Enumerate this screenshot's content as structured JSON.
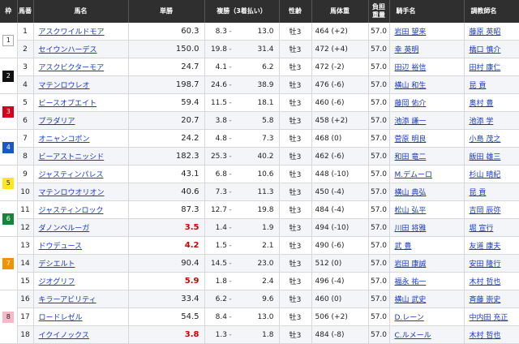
{
  "headers": {
    "waku": "枠",
    "umaban": "馬番",
    "horse": "馬名",
    "win_odds": "単勝",
    "place_odds": "複勝（3着払い）",
    "sex_age": "性齢",
    "body_weight": "馬体重",
    "weight_line1": "負担",
    "weight_line2": "重量",
    "jockey": "騎手名",
    "trainer": "調教師名"
  },
  "waku_colors": {
    "1": {
      "bg": "#ffffff",
      "fg": "#222222"
    },
    "2": {
      "bg": "#111111",
      "fg": "#ffffff"
    },
    "3": {
      "bg": "#d6001c",
      "fg": "#ffffff"
    },
    "4": {
      "bg": "#1a57c9",
      "fg": "#ffffff"
    },
    "5": {
      "bg": "#ffe81a",
      "fg": "#222222"
    },
    "6": {
      "bg": "#14863a",
      "fg": "#ffffff"
    },
    "7": {
      "bg": "#f39200",
      "fg": "#ffffff"
    },
    "8": {
      "bg": "#f7b8c8",
      "fg": "#222222"
    }
  },
  "rows": [
    {
      "waku": "1",
      "num": "1",
      "horse": "アスクワイルドモア",
      "win": "60.3",
      "hot": false,
      "pmin": "8.3",
      "pmax": "13.0",
      "sex": "牡3",
      "bw": "464 (+2)",
      "wt": "57.0",
      "jockey": "岩田 望来",
      "trainer": "藤原 英昭"
    },
    {
      "waku": "1",
      "num": "2",
      "horse": "セイウンハーデス",
      "win": "150.0",
      "hot": false,
      "pmin": "19.8",
      "pmax": "31.4",
      "sex": "牡3",
      "bw": "472 (+4)",
      "wt": "57.0",
      "jockey": "幸 英明",
      "trainer": "橋口 慎介"
    },
    {
      "waku": "2",
      "num": "3",
      "horse": "アスクビクターモア",
      "win": "24.7",
      "hot": false,
      "pmin": "4.1",
      "pmax": "6.2",
      "sex": "牡3",
      "bw": "472 (-2)",
      "wt": "57.0",
      "jockey": "田辺 裕信",
      "trainer": "田村 康仁"
    },
    {
      "waku": "2",
      "num": "4",
      "horse": "マテンロウレオ",
      "win": "198.7",
      "hot": false,
      "pmin": "24.6",
      "pmax": "38.9",
      "sex": "牡3",
      "bw": "476 (-6)",
      "wt": "57.0",
      "jockey": "横山 和生",
      "trainer": "昆 貢"
    },
    {
      "waku": "3",
      "num": "5",
      "horse": "ビースオブエイト",
      "win": "59.4",
      "hot": false,
      "pmin": "11.5",
      "pmax": "18.1",
      "sex": "牡3",
      "bw": "460 (-6)",
      "wt": "57.0",
      "jockey": "藤岡 佑介",
      "trainer": "奥村 豊"
    },
    {
      "waku": "3",
      "num": "6",
      "horse": "プラダリア",
      "win": "20.7",
      "hot": false,
      "pmin": "3.8",
      "pmax": "5.8",
      "sex": "牡3",
      "bw": "458 (+2)",
      "wt": "57.0",
      "jockey": "池添 謙一",
      "trainer": "池添 学"
    },
    {
      "waku": "4",
      "num": "7",
      "horse": "オニャンコポン",
      "win": "24.2",
      "hot": false,
      "pmin": "4.8",
      "pmax": "7.3",
      "sex": "牡3",
      "bw": "468 (0)",
      "wt": "57.0",
      "jockey": "菅原 明良",
      "trainer": "小島 茂之"
    },
    {
      "waku": "4",
      "num": "8",
      "horse": "ビーアストニッシド",
      "win": "182.3",
      "hot": false,
      "pmin": "25.3",
      "pmax": "40.2",
      "sex": "牡3",
      "bw": "462 (-6)",
      "wt": "57.0",
      "jockey": "和田 竜二",
      "trainer": "飯田 雄三"
    },
    {
      "waku": "5",
      "num": "9",
      "horse": "ジャスティンパレス",
      "win": "43.1",
      "hot": false,
      "pmin": "6.8",
      "pmax": "10.6",
      "sex": "牡3",
      "bw": "448 (-10)",
      "wt": "57.0",
      "jockey": "M.デムーロ",
      "trainer": "杉山 晴紀"
    },
    {
      "waku": "5",
      "num": "10",
      "horse": "マテンロウオリオン",
      "win": "40.6",
      "hot": false,
      "pmin": "7.3",
      "pmax": "11.3",
      "sex": "牡3",
      "bw": "450 (-4)",
      "wt": "57.0",
      "jockey": "横山 典弘",
      "trainer": "昆 貢"
    },
    {
      "waku": "6",
      "num": "11",
      "horse": "ジャスティンロック",
      "win": "87.3",
      "hot": false,
      "pmin": "12.7",
      "pmax": "19.8",
      "sex": "牡3",
      "bw": "484 (-4)",
      "wt": "57.0",
      "jockey": "松山 弘平",
      "trainer": "吉岡 辰弥"
    },
    {
      "waku": "6",
      "num": "12",
      "horse": "ダノンベルーガ",
      "win": "3.5",
      "hot": true,
      "pmin": "1.4",
      "pmax": "1.9",
      "sex": "牡3",
      "bw": "494 (-10)",
      "wt": "57.0",
      "jockey": "川田 将雅",
      "trainer": "堀 宣行"
    },
    {
      "waku": "7",
      "num": "13",
      "horse": "ドウデュース",
      "win": "4.2",
      "hot": true,
      "pmin": "1.5",
      "pmax": "2.1",
      "sex": "牡3",
      "bw": "490 (-6)",
      "wt": "57.0",
      "jockey": "武 豊",
      "trainer": "友道 康夫"
    },
    {
      "waku": "7",
      "num": "14",
      "horse": "デシエルト",
      "win": "90.4",
      "hot": false,
      "pmin": "14.5",
      "pmax": "23.0",
      "sex": "牡3",
      "bw": "512 (0)",
      "wt": "57.0",
      "jockey": "岩田 康誠",
      "trainer": "安田 隆行"
    },
    {
      "waku": "7",
      "num": "15",
      "horse": "ジオグリフ",
      "win": "5.9",
      "hot": true,
      "pmin": "1.8",
      "pmax": "2.4",
      "sex": "牡3",
      "bw": "496 (-4)",
      "wt": "57.0",
      "jockey": "福永 祐一",
      "trainer": "木村 哲也"
    },
    {
      "waku": "8",
      "num": "16",
      "horse": "キラーアビリティ",
      "win": "33.4",
      "hot": false,
      "pmin": "6.2",
      "pmax": "9.6",
      "sex": "牡3",
      "bw": "460 (0)",
      "wt": "57.0",
      "jockey": "横山 武史",
      "trainer": "斉藤 崇史"
    },
    {
      "waku": "8",
      "num": "17",
      "horse": "ロードレゼル",
      "win": "54.5",
      "hot": false,
      "pmin": "8.4",
      "pmax": "13.0",
      "sex": "牡3",
      "bw": "506 (+2)",
      "wt": "57.0",
      "jockey": "D.レーン",
      "trainer": "中内田 充正"
    },
    {
      "waku": "8",
      "num": "18",
      "horse": "イクイノックス",
      "win": "3.8",
      "hot": true,
      "pmin": "1.3",
      "pmax": "1.8",
      "sex": "牡3",
      "bw": "484 (-8)",
      "wt": "57.0",
      "jockey": "C.ルメール",
      "trainer": "木村 哲也"
    }
  ]
}
